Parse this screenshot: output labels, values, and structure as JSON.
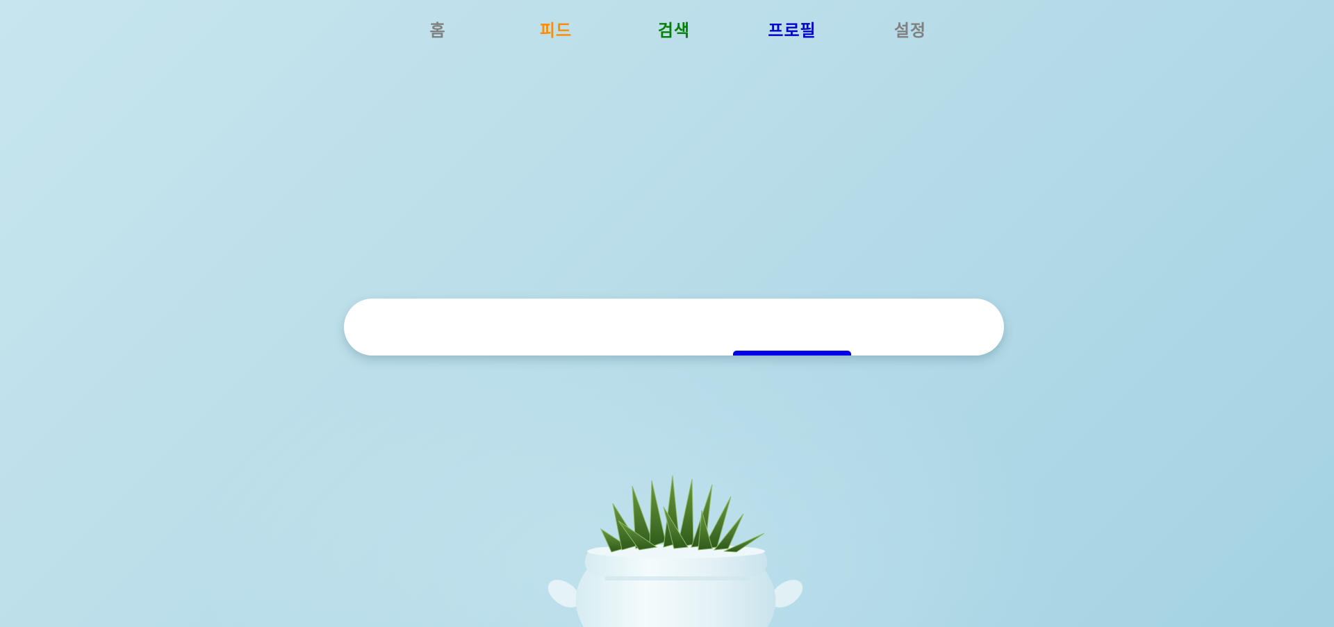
{
  "tabs": [
    {
      "label": "홈",
      "color": "#808080"
    },
    {
      "label": "피드",
      "color": "#ff8c00"
    },
    {
      "label": "검색",
      "color": "#008000"
    },
    {
      "label": "프로필",
      "color": "#0000cd"
    },
    {
      "label": "설정",
      "color": "#808080"
    }
  ],
  "active_tab": "프로필",
  "colors": {
    "indicator": "#0000e6",
    "tabbar_background": "#ffffff",
    "page_background": "#bfe0eb"
  },
  "background_image": "succulent-plant-in-white-pot"
}
